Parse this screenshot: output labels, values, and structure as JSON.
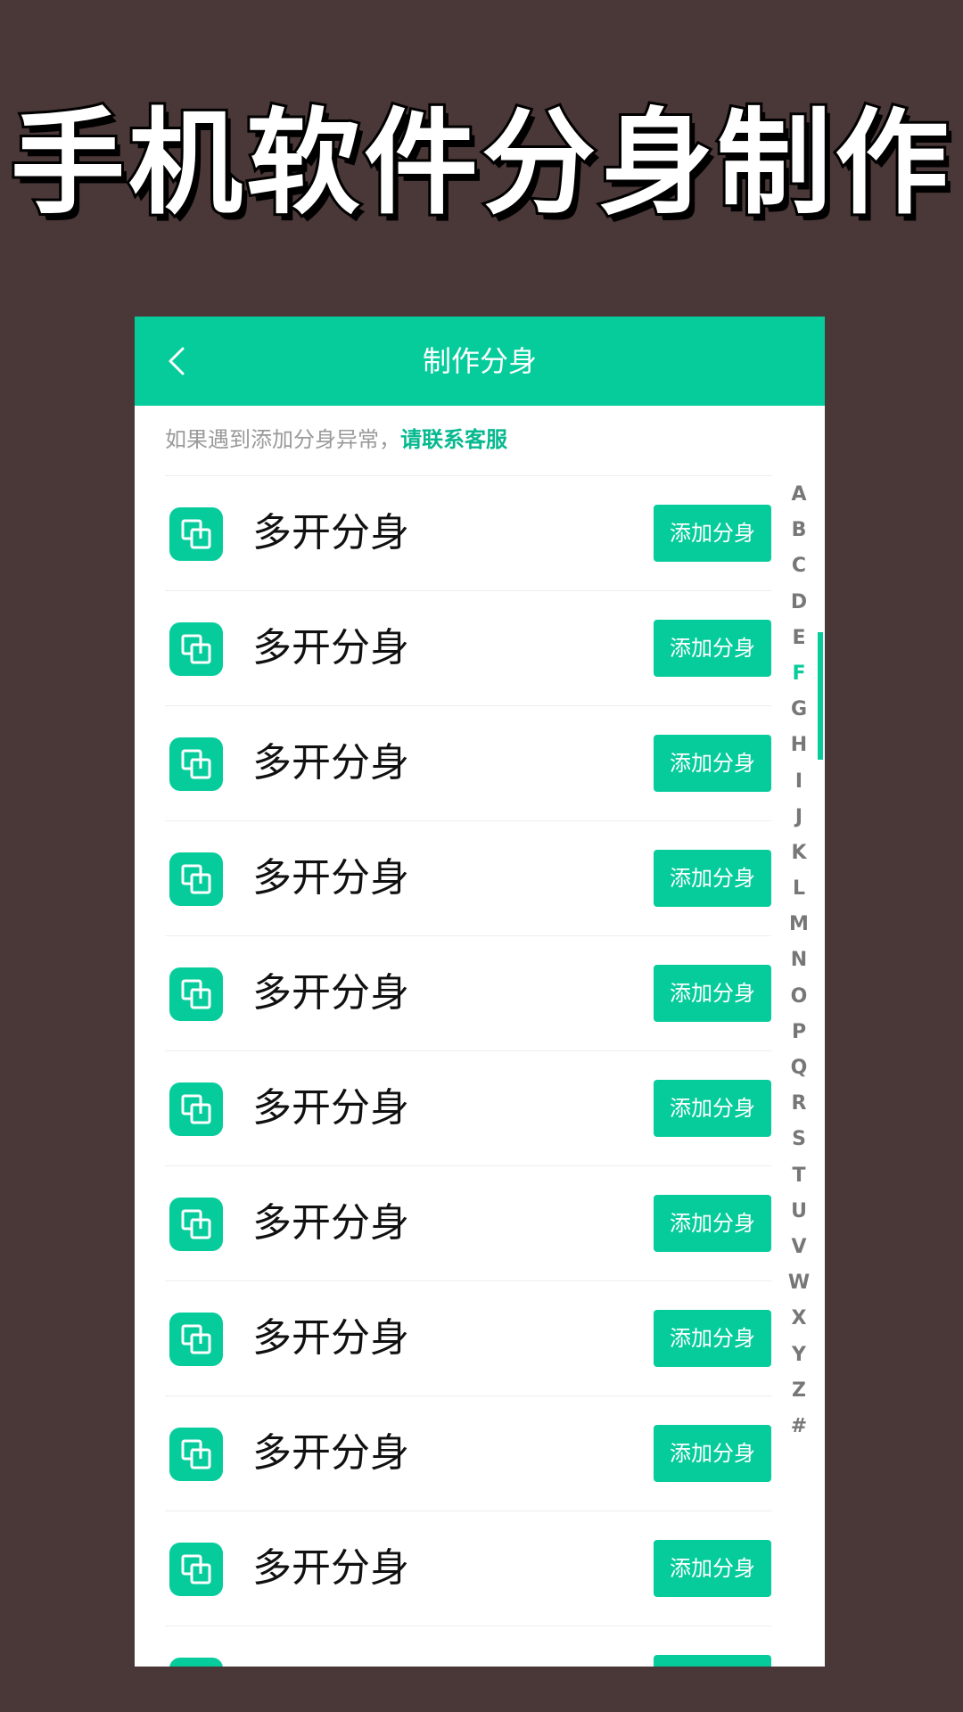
{
  "promo": {
    "title": "手机软件分身制作"
  },
  "header": {
    "back_icon": "chevron-left-icon",
    "title": "制作分身"
  },
  "notice": {
    "text": "如果遇到添加分身异常，",
    "link": "请联系客服"
  },
  "list": {
    "items": [
      {
        "name": "多开分身",
        "button": "添加分身"
      },
      {
        "name": "多开分身",
        "button": "添加分身"
      },
      {
        "name": "多开分身",
        "button": "添加分身"
      },
      {
        "name": "多开分身",
        "button": "添加分身"
      },
      {
        "name": "多开分身",
        "button": "添加分身"
      },
      {
        "name": "多开分身",
        "button": "添加分身"
      },
      {
        "name": "多开分身",
        "button": "添加分身"
      },
      {
        "name": "多开分身",
        "button": "添加分身"
      },
      {
        "name": "多开分身",
        "button": "添加分身"
      },
      {
        "name": "多开分身",
        "button": "添加分身"
      }
    ],
    "item_icon": "clone-app-icon"
  },
  "index_bar": {
    "letters": [
      "A",
      "B",
      "C",
      "D",
      "E",
      "F",
      "G",
      "H",
      "I",
      "J",
      "K",
      "L",
      "M",
      "N",
      "O",
      "P",
      "Q",
      "R",
      "S",
      "T",
      "U",
      "V",
      "W",
      "X",
      "Y",
      "Z",
      "#"
    ],
    "active": "F"
  },
  "colors": {
    "accent": "#06cc9c",
    "background": "#4a3737",
    "link": "#06b98f"
  }
}
